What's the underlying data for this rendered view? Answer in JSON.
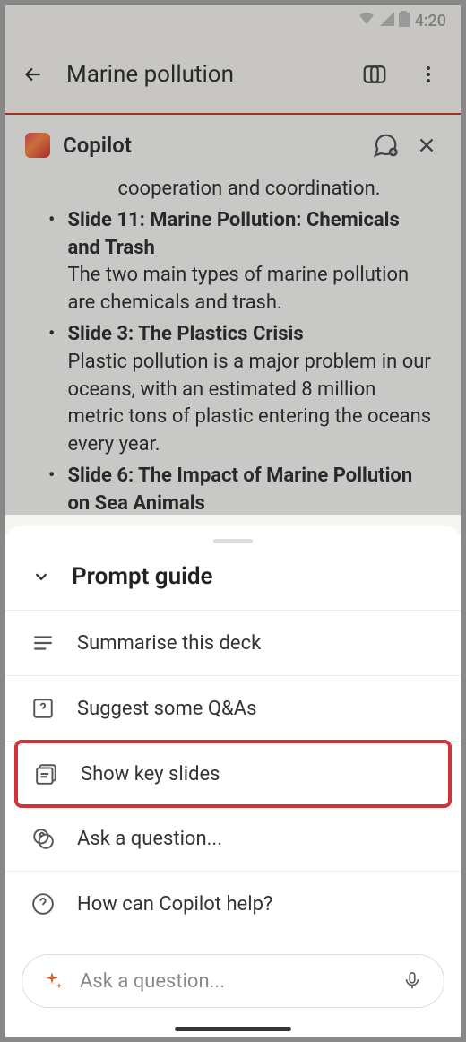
{
  "status": {
    "time": "4:20"
  },
  "header": {
    "title": "Marine pollution"
  },
  "copilot": {
    "title": "Copilot",
    "partial_line": "cooperation and coordination.",
    "bullets": [
      {
        "title": "Slide 11: Marine Pollution: Chemicals and Trash",
        "body": "The two main types of marine pollution are chemicals and trash."
      },
      {
        "title": "Slide 3: The Plastics Crisis",
        "body": "Plastic pollution is a major problem in our oceans, with an estimated 8 million metric tons of plastic entering the oceans every year."
      },
      {
        "title": "Slide 6: The Impact of Marine Pollution on Sea Animals",
        "body": ""
      }
    ]
  },
  "sheet": {
    "title": "Prompt guide",
    "options": {
      "summarise": "Summarise this deck",
      "qas": "Suggest some Q&As",
      "keyslides": "Show key slides",
      "ask": "Ask a question...",
      "help": "How can Copilot help?"
    }
  },
  "input": {
    "placeholder": "Ask a question..."
  }
}
